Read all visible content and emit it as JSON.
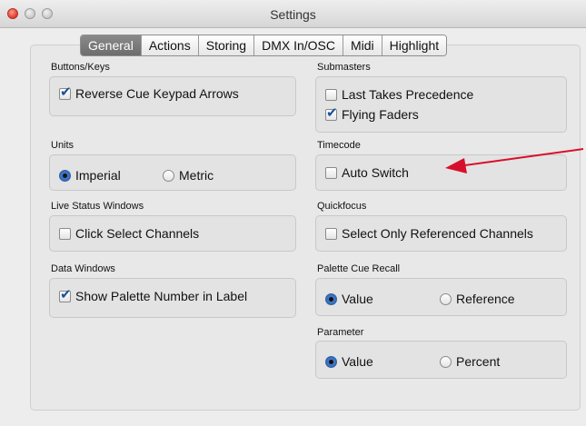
{
  "window": {
    "title": "Settings"
  },
  "tabs": [
    "General",
    "Actions",
    "Storing",
    "DMX In/OSC",
    "Midi",
    "Highlight"
  ],
  "active_tab": "General",
  "sections": {
    "buttons_keys": {
      "label": "Buttons/Keys",
      "reverse_cue": {
        "label": "Reverse Cue Keypad Arrows",
        "checked": true
      }
    },
    "units": {
      "label": "Units",
      "imperial": {
        "label": "Imperial",
        "selected": true
      },
      "metric": {
        "label": "Metric",
        "selected": false
      }
    },
    "live_status": {
      "label": "Live Status Windows",
      "click_select": {
        "label": "Click Select Channels",
        "checked": false
      }
    },
    "data_windows": {
      "label": "Data Windows",
      "show_palette": {
        "label": "Show Palette Number in Label",
        "checked": true
      }
    },
    "submasters": {
      "label": "Submasters",
      "last_takes": {
        "label": "Last Takes Precedence",
        "checked": false
      },
      "flying_faders": {
        "label": "Flying Faders",
        "checked": true
      }
    },
    "timecode": {
      "label": "Timecode",
      "auto_switch": {
        "label": "Auto Switch",
        "checked": false
      }
    },
    "quickfocus": {
      "label": "Quickfocus",
      "select_only": {
        "label": "Select Only Referenced Channels",
        "checked": false
      }
    },
    "palette_cue_recall": {
      "label": "Palette Cue Recall",
      "value": {
        "label": "Value",
        "selected": true
      },
      "reference": {
        "label": "Reference",
        "selected": false
      }
    },
    "parameter": {
      "label": "Parameter",
      "value": {
        "label": "Value",
        "selected": true
      },
      "percent": {
        "label": "Percent",
        "selected": false
      }
    }
  },
  "colors": {
    "annotation_arrow": "#d6102a",
    "checkmark": "#1b4f99",
    "radio_selected": "#2a5fb0"
  }
}
